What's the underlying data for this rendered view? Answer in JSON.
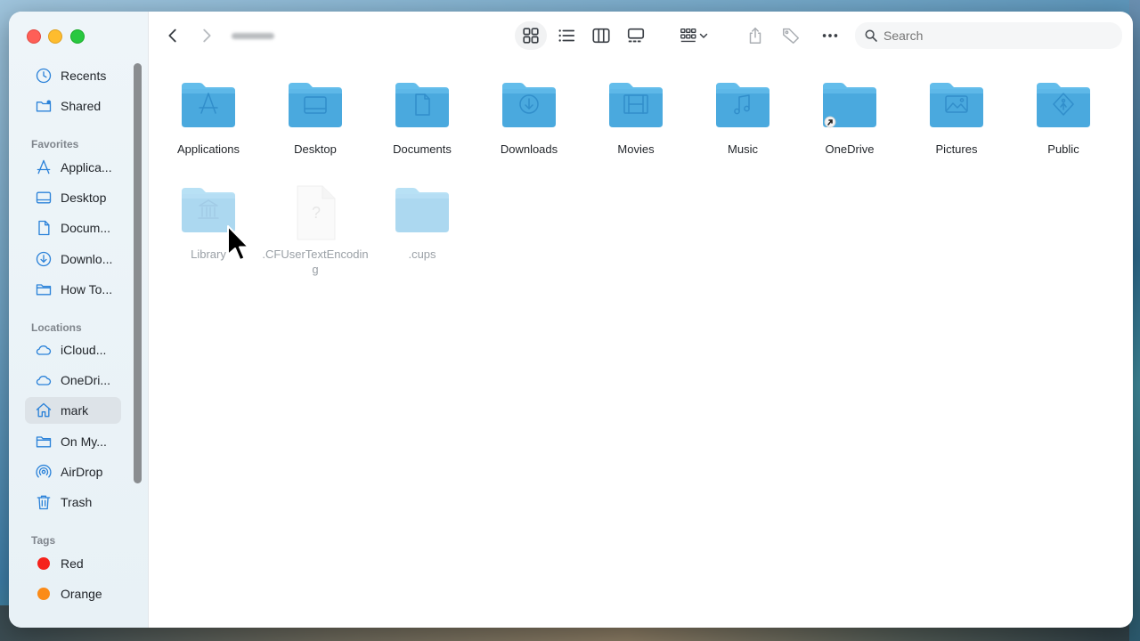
{
  "window": {
    "title": ""
  },
  "sidebar": {
    "top_items": [
      {
        "label": "Recents",
        "icon": "clock-icon"
      },
      {
        "label": "Shared",
        "icon": "shared-folder-icon"
      }
    ],
    "favorites_title": "Favorites",
    "favorites": [
      {
        "label": "Applica...",
        "icon": "applications-icon"
      },
      {
        "label": "Desktop",
        "icon": "desktop-icon"
      },
      {
        "label": "Docum...",
        "icon": "document-icon"
      },
      {
        "label": "Downlo...",
        "icon": "download-icon"
      },
      {
        "label": "How To...",
        "icon": "folder-icon"
      }
    ],
    "locations_title": "Locations",
    "locations": [
      {
        "label": "iCloud...",
        "icon": "cloud-icon"
      },
      {
        "label": "OneDri...",
        "icon": "cloud-icon"
      },
      {
        "label": "mark",
        "icon": "home-icon",
        "active": true
      },
      {
        "label": "On My...",
        "icon": "folder-icon"
      },
      {
        "label": "AirDrop",
        "icon": "airdrop-icon"
      },
      {
        "label": "Trash",
        "icon": "trash-icon"
      }
    ],
    "tags_title": "Tags",
    "tags": [
      {
        "label": "Red",
        "color": "#f5221b"
      },
      {
        "label": "Orange",
        "color": "#fb8b18"
      }
    ]
  },
  "toolbar": {
    "search_placeholder": "Search",
    "views": [
      "icon-view",
      "list-view",
      "column-view",
      "gallery-view"
    ]
  },
  "files": [
    {
      "label": "Applications",
      "glyph": "applications"
    },
    {
      "label": "Desktop",
      "glyph": "desktop"
    },
    {
      "label": "Documents",
      "glyph": "document"
    },
    {
      "label": "Downloads",
      "glyph": "download"
    },
    {
      "label": "Movies",
      "glyph": "film"
    },
    {
      "label": "Music",
      "glyph": "music"
    },
    {
      "label": "OneDrive",
      "glyph": "alias"
    },
    {
      "label": "Pictures",
      "glyph": "picture"
    },
    {
      "label": "Public",
      "glyph": "public"
    },
    {
      "label": "Library",
      "glyph": "library",
      "hidden": true
    },
    {
      "label": ".CFUserTextEncoding",
      "glyph": "unknown-file",
      "hidden": true
    },
    {
      "label": ".cups",
      "glyph": "plain",
      "hidden": true
    }
  ],
  "colors": {
    "folder_top": "#5ab9ea",
    "folder_body": "#49a9df",
    "accent": "#2b82d9"
  }
}
